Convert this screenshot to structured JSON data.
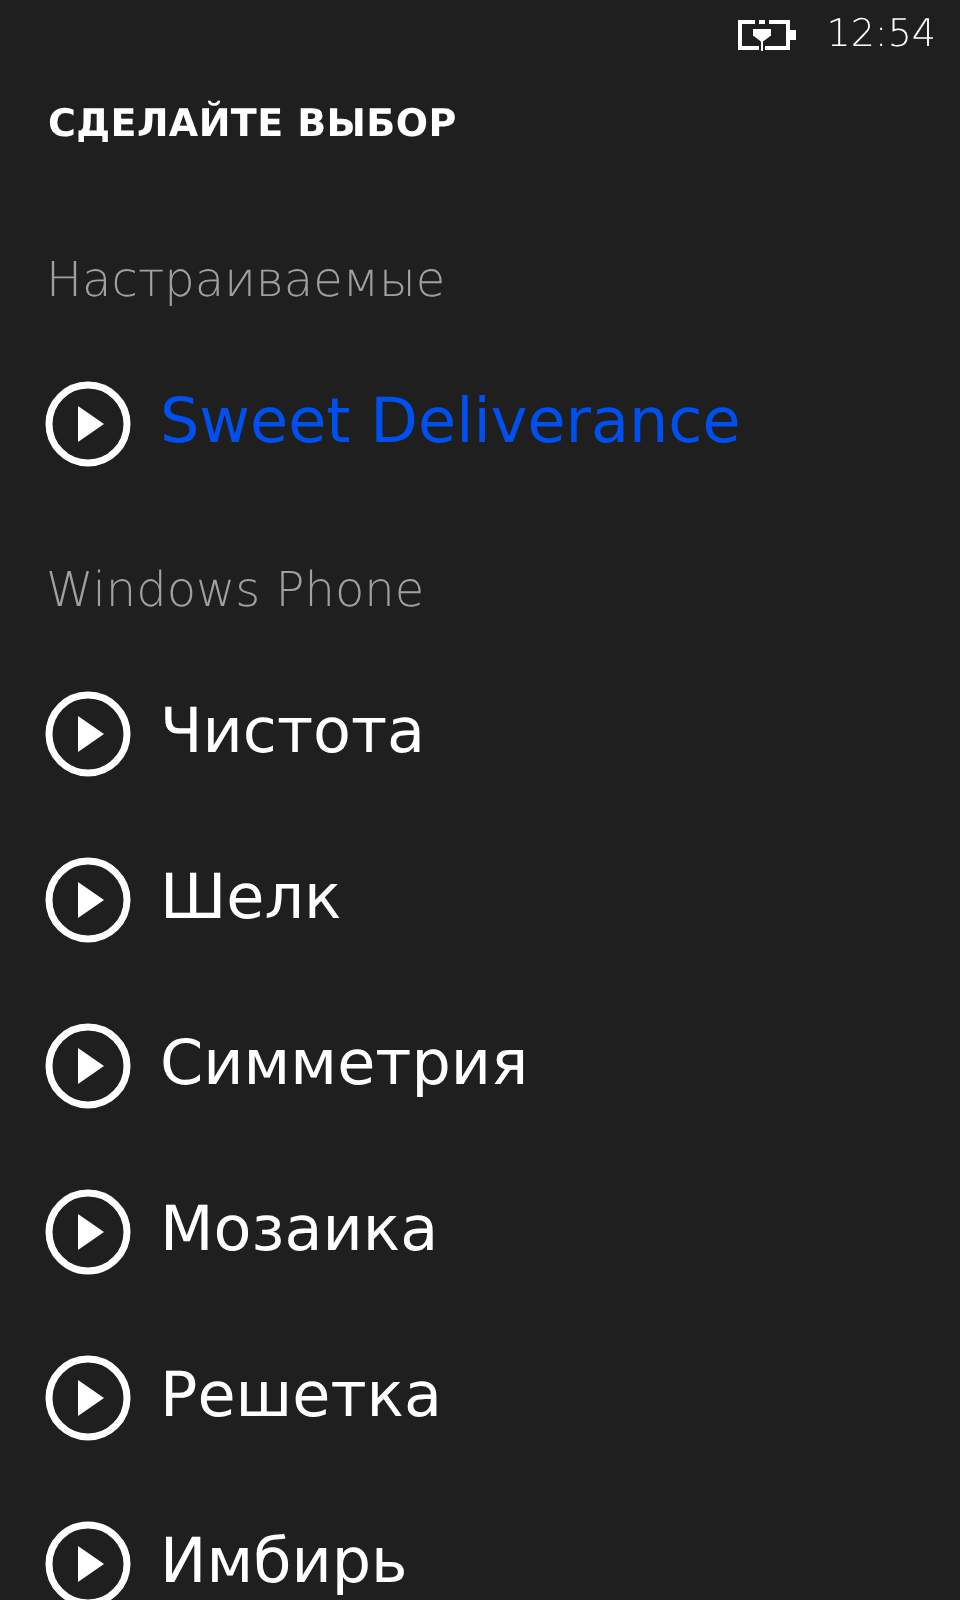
{
  "status_bar": {
    "battery_charging": true,
    "time": "12:54"
  },
  "title": "СДЕЛАЙТЕ ВЫБОР",
  "groups": [
    {
      "header": "Настраиваемые",
      "items": [
        {
          "label": "Sweet Deliverance",
          "selected": true
        }
      ]
    },
    {
      "header": "Windows Phone",
      "items": [
        {
          "label": "Чистота",
          "selected": false
        },
        {
          "label": "Шелк",
          "selected": false
        },
        {
          "label": "Симметрия",
          "selected": false
        },
        {
          "label": "Мозаика",
          "selected": false
        },
        {
          "label": "Решетка",
          "selected": false
        },
        {
          "label": "Имбирь",
          "selected": false
        }
      ]
    }
  ]
}
